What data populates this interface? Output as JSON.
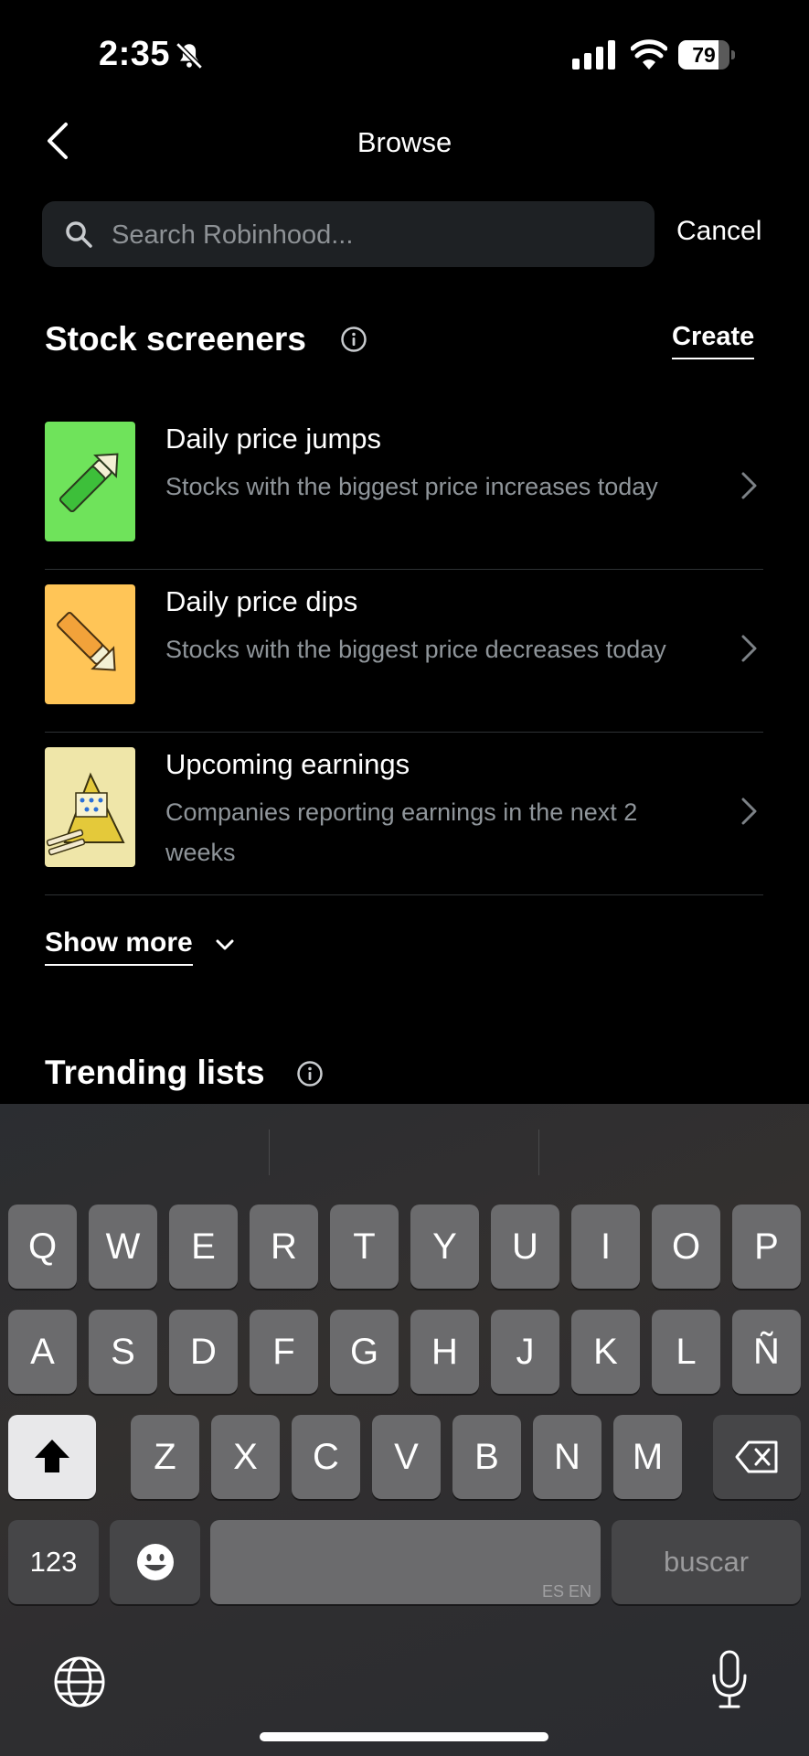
{
  "status_bar": {
    "time": "2:35",
    "battery": "79",
    "battery_level": 0.79
  },
  "nav": {
    "title": "Browse"
  },
  "search": {
    "placeholder": "Search Robinhood...",
    "cancel_label": "Cancel"
  },
  "stock_screeners": {
    "title": "Stock screeners",
    "create_label": "Create",
    "items": [
      {
        "title": "Daily price jumps",
        "description": "Stocks with the biggest price increases today",
        "thumb_color": "#6fe35b"
      },
      {
        "title": "Daily price dips",
        "description": "Stocks with the biggest price decreases today",
        "thumb_color": "#ffc557"
      },
      {
        "title": "Upcoming earnings",
        "description": "Companies reporting earnings in the next 2 weeks",
        "thumb_color": "#efe6a9"
      }
    ],
    "show_more_label": "Show more"
  },
  "trending_lists": {
    "title": "Trending lists"
  },
  "keyboard": {
    "row1": [
      "Q",
      "W",
      "E",
      "R",
      "T",
      "Y",
      "U",
      "I",
      "O",
      "P"
    ],
    "row2": [
      "A",
      "S",
      "D",
      "F",
      "G",
      "H",
      "J",
      "K",
      "L",
      "Ñ"
    ],
    "row3": [
      "Z",
      "X",
      "C",
      "V",
      "B",
      "N",
      "M"
    ],
    "numbers_label": "123",
    "space_lang_label": "ES EN",
    "return_label": "buscar"
  }
}
